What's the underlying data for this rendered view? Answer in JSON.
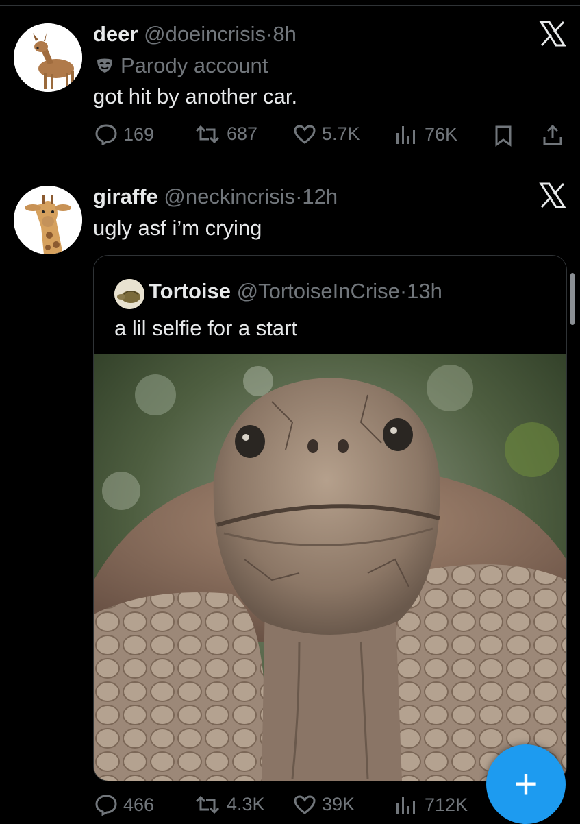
{
  "tweets": [
    {
      "name": "deer",
      "handle": "@doeincrisis",
      "separator": "·",
      "time": "8h",
      "label": "Parody account",
      "text": "got hit by another car.",
      "replies": "169",
      "reposts": "687",
      "likes": "5.7K",
      "views": "76K",
      "avatar_icon": "deer-avatar"
    },
    {
      "name": "giraffe",
      "handle": "@neckincrisis",
      "separator": "·",
      "time": "12h",
      "text": "ugly asf i’m crying",
      "replies": "466",
      "reposts": "4.3K",
      "likes": "39K",
      "views": "712K",
      "avatar_icon": "giraffe-avatar"
    }
  ],
  "quote": {
    "name": "Tortoise",
    "handle": "@TortoiseInCrise",
    "separator": "·",
    "time": "13h",
    "text": "a lil selfie for a start",
    "image_icon": "tortoise-photo"
  },
  "compose_label": "+",
  "colors": {
    "background": "#000000",
    "text": "#e7e9ea",
    "muted": "#71767b",
    "divider": "#2f3336",
    "accent": "#1d9bf0"
  }
}
